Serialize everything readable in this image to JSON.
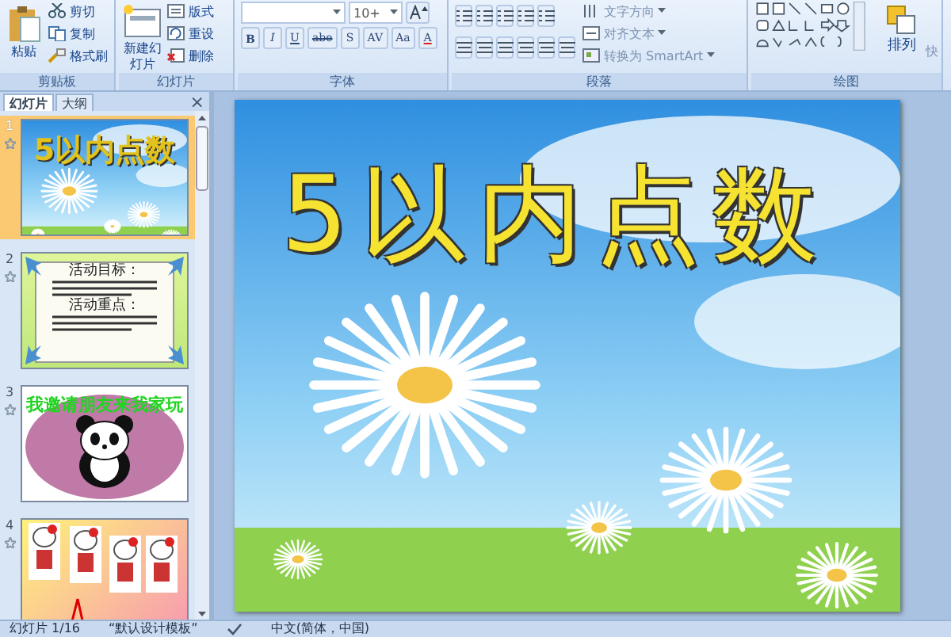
{
  "ribbon": {
    "groups": [
      {
        "kind": "clipboard",
        "label": "剪贴板",
        "large": "粘贴",
        "small": [
          "剪切",
          "复制",
          "格式刷"
        ]
      },
      {
        "kind": "slides",
        "label": "幻灯片",
        "large": "新建幻灯片",
        "small": [
          "版式",
          "重设",
          "删除"
        ]
      },
      {
        "kind": "font",
        "label": "字体",
        "font_size": "10+",
        "format": [
          "B",
          "I",
          "U",
          "abe",
          "S",
          "AV",
          "Aa",
          "A"
        ]
      },
      {
        "kind": "paragraph",
        "label": "段落",
        "small": [
          "文字方向",
          "对齐文本",
          "转换为 SmartArt"
        ]
      },
      {
        "kind": "drawing",
        "label": "绘图",
        "large": "排列",
        "cut": "快"
      }
    ]
  },
  "panel": {
    "tabs": [
      {
        "label": "幻灯片",
        "selected": true
      },
      {
        "label": "大纲",
        "selected": false
      }
    ],
    "close": "×",
    "thumbnails": [
      {
        "number": "1",
        "kind": "title",
        "selected": true,
        "texts": [
          "5以内点数"
        ]
      },
      {
        "number": "2",
        "kind": "goals",
        "selected": false,
        "texts": [
          "活动目标：",
          "活动重点："
        ]
      },
      {
        "number": "3",
        "kind": "panda",
        "selected": false,
        "texts": [
          "我邀请朋友来我家玩"
        ]
      },
      {
        "number": "4",
        "kind": "kitty",
        "selected": false
      }
    ]
  },
  "slide": {
    "title": "5以内点数"
  },
  "status_bar": {
    "slide": "幻灯片 1/16",
    "theme": "“默认设计模板”",
    "language": "中文(简体，中国)"
  }
}
